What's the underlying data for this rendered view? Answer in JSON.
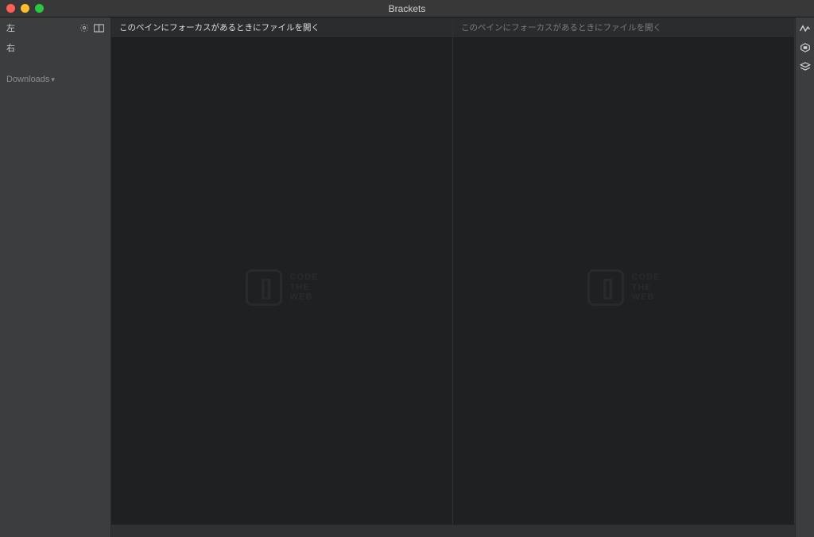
{
  "window": {
    "title": "Brackets"
  },
  "sidebar": {
    "left_label": "左",
    "right_label": "右",
    "project_name": "Downloads",
    "dropdown_indicator": "▾"
  },
  "panes": {
    "left_hint": "このペインにフォーカスがあるときにファイルを開く",
    "right_hint": "このペインにフォーカスがあるときにファイルを開く"
  },
  "watermark": {
    "bracket_glyph": "[ ]",
    "line1": "CODE",
    "line2": "THE",
    "line3": "WEB"
  }
}
